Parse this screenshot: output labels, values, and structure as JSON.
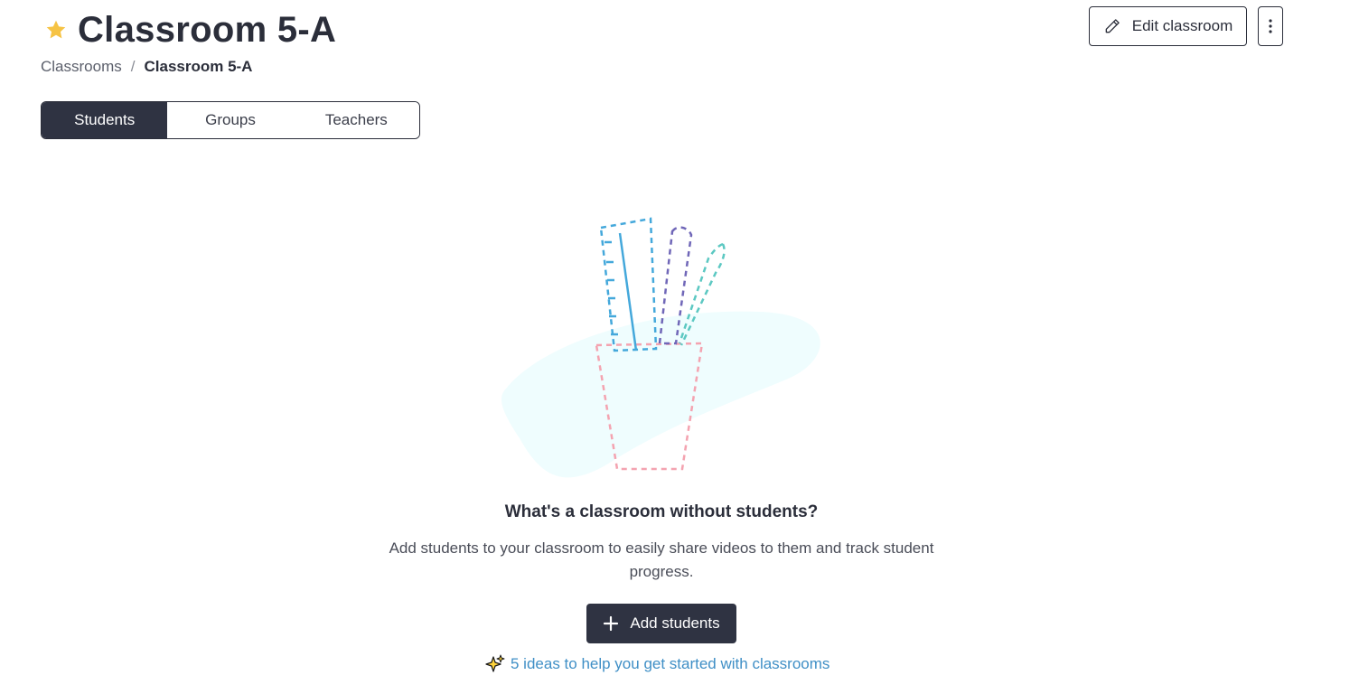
{
  "header": {
    "title": "Classroom 5-A",
    "star_icon": "star-icon",
    "star_color": "#f6c344"
  },
  "breadcrumb": {
    "parent": "Classrooms",
    "separator": "/",
    "current": "Classroom 5-A"
  },
  "actions": {
    "edit_label": "Edit classroom",
    "edit_icon": "pencil-icon",
    "more_icon": "vertical-dots-icon"
  },
  "tabs": [
    {
      "label": "Students",
      "active": true
    },
    {
      "label": "Groups",
      "active": false
    },
    {
      "label": "Teachers",
      "active": false
    }
  ],
  "empty_state": {
    "illustration": "pencil-cup-illustration",
    "heading": "What's a classroom without students?",
    "description": "Add students to your classroom to easily share videos to them and track student progress.",
    "add_button_label": "Add students",
    "add_icon": "plus-icon",
    "ideas_link_label": "5 ideas to help you get started with classrooms",
    "ideas_icon": "sparkles-icon"
  },
  "colors": {
    "primary_dark": "#2f3342",
    "link": "#3f8fc6",
    "star": "#f6c344"
  }
}
